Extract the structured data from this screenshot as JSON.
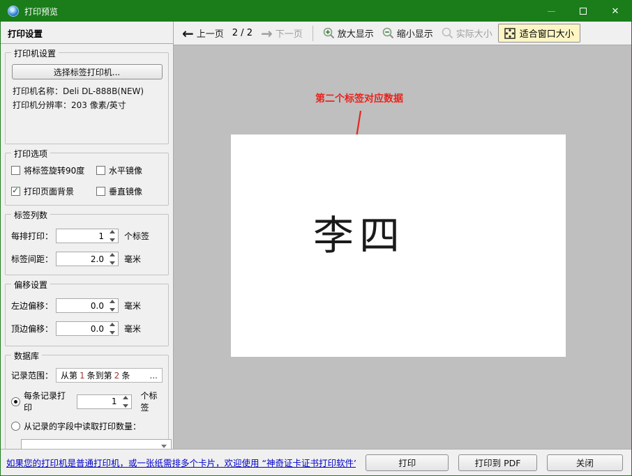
{
  "window": {
    "title": "打印预览"
  },
  "colors": {
    "titlebar_green": "#1a7d1a",
    "preview_bg": "#bfbfbf",
    "annotation_red": "#e8241d",
    "link_blue": "#0000c8",
    "fit_button_bg": "#fdf5c4"
  },
  "toolbar": {
    "prev_label": "上一页",
    "page_indicator": "2 / 2",
    "next_label": "下一页",
    "zoom_in_label": "放大显示",
    "zoom_out_label": "缩小显示",
    "actual_size_label": "实际大小",
    "fit_window_label": "适合窗口大小"
  },
  "sidebar": {
    "header": "打印设置",
    "printer": {
      "title": "打印机设置",
      "select_button": "选择标签打印机...",
      "name_label": "打印机名称：",
      "name_value": "Deli DL-888B(NEW)",
      "resolution_label": "打印机分辨率：",
      "resolution_value": "203 像素/英寸"
    },
    "options": {
      "title": "打印选项",
      "checkboxes": [
        {
          "label": "将标签旋转90度",
          "checked": false
        },
        {
          "label": "水平镜像",
          "checked": false
        },
        {
          "label": "打印页面背景",
          "checked": true
        },
        {
          "label": "垂直镜像",
          "checked": false
        }
      ]
    },
    "columns": {
      "title": "标签列数",
      "rows": [
        {
          "label": "每排打印：",
          "value": "1",
          "unit": "个标签"
        },
        {
          "label": "标签间距：",
          "value": "2.0",
          "unit": "毫米"
        }
      ]
    },
    "offset": {
      "title": "偏移设置",
      "rows": [
        {
          "label": "左边偏移：",
          "value": "0.0",
          "unit": "毫米"
        },
        {
          "label": "顶边偏移：",
          "value": "0.0",
          "unit": "毫米"
        }
      ]
    },
    "database": {
      "title": "数据库",
      "range_label": "记录范围：",
      "range_prefix": "从第",
      "range_from": "1",
      "range_mid": "条到第",
      "range_to": "2",
      "range_suffix": "条",
      "range_browse": "...",
      "radio_per_record": {
        "label": "每条记录打印",
        "selected": true,
        "value": "1",
        "unit": "个标签"
      },
      "radio_from_field": {
        "label": "从记录的字段中读取打印数量：",
        "selected": false
      },
      "field_dropdown_value": ""
    }
  },
  "preview": {
    "annotation": "第二个标签对应数据",
    "label_text": "李四"
  },
  "bottom": {
    "link_text": "如果您的打印机是普通打印机，或一张纸需排多个卡片，欢迎使用 “神奇证卡证书打印软件”",
    "print_label": "打印",
    "print_pdf_label": "打印到 PDF",
    "close_label": "关闭"
  }
}
